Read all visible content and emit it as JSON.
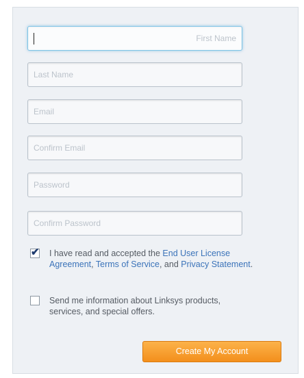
{
  "form": {
    "fields": [
      {
        "name": "first-name-input",
        "placeholder": "First Name",
        "value": ""
      },
      {
        "name": "last-name-input",
        "placeholder": "Last Name",
        "value": ""
      },
      {
        "name": "email-input",
        "placeholder": "Email",
        "value": ""
      },
      {
        "name": "confirm-email-input",
        "placeholder": "Confirm Email",
        "value": ""
      },
      {
        "name": "password-input",
        "placeholder": "Password",
        "value": ""
      },
      {
        "name": "confirm-password-input",
        "placeholder": "Confirm Password",
        "value": ""
      }
    ],
    "agreement": {
      "checked": true,
      "text_before": "I have read and accepted the ",
      "eula_link": "End User License Agreement",
      "sep1": ", ",
      "tos_link": "Terms of Service",
      "sep2": ", and ",
      "privacy_link": "Privacy Statement",
      "text_after": "."
    },
    "newsletter": {
      "checked": false,
      "text": "Send me information about Linksys products, services, and special offers."
    },
    "submit_label": "Create My Account"
  },
  "colors": {
    "link": "#3b73b9",
    "button_top": "#fcb24a",
    "button_bottom": "#f38f1c",
    "focus_border": "#7fc4e6"
  }
}
